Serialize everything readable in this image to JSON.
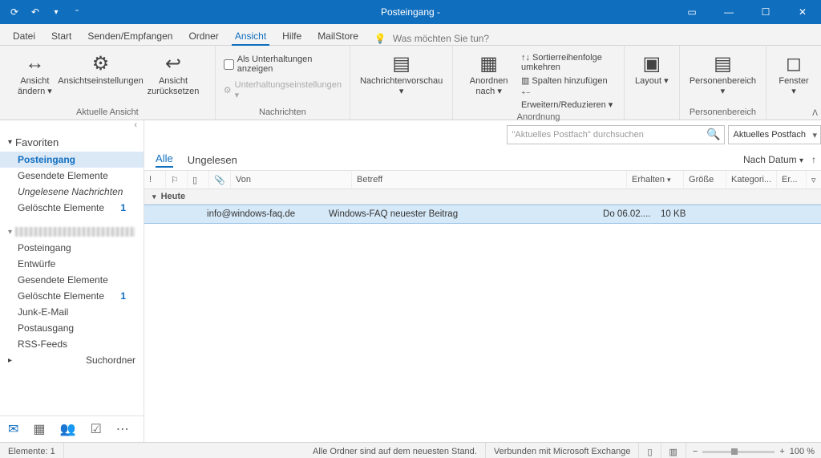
{
  "title": "Posteingang -",
  "tabs": [
    "Datei",
    "Start",
    "Senden/Empfangen",
    "Ordner",
    "Ansicht",
    "Hilfe",
    "MailStore"
  ],
  "active_tab": 4,
  "tell_placeholder": "Was möchten Sie tun?",
  "ribbon": {
    "g1": {
      "label": "Aktuelle Ansicht",
      "btn1": "Ansicht\nändern ▾",
      "btn2": "Ansichtseinstellungen",
      "btn3": "Ansicht\nzurücksetzen"
    },
    "g2": {
      "label": "Nachrichten",
      "chk": "Als Unterhaltungen anzeigen",
      "dis": "Unterhaltungseinstellungen ▾",
      "btn": "Nachrichtenvorschau\n▾"
    },
    "g3": {
      "label": "Anordnung",
      "btn": "Anordnen\nnach ▾",
      "l1": "↑↓ Sortierreihenfolge umkehren",
      "l2": "▥ Spalten hinzufügen",
      "l3": "⁺⁻ Erweitern/Reduzieren ▾"
    },
    "g4": {
      "label": "",
      "btn": "Layout\n▾"
    },
    "g5": {
      "label": "Personenbereich",
      "btn": "Personenbereich\n▾"
    },
    "g6": {
      "label": "",
      "btn": "Fenster\n▾"
    }
  },
  "nav": {
    "fav": "Favoriten",
    "fav_items": [
      {
        "name": "Posteingang",
        "sel": true,
        "bold": true
      },
      {
        "name": "Gesendete Elemente"
      },
      {
        "name": "Ungelesene Nachrichten",
        "ital": true
      },
      {
        "name": "Gelöschte Elemente",
        "count": "1"
      }
    ],
    "acct_items": [
      {
        "name": "Posteingang"
      },
      {
        "name": "Entwürfe"
      },
      {
        "name": "Gesendete Elemente"
      },
      {
        "name": "Gelöschte Elemente",
        "count": "1"
      },
      {
        "name": "Junk-E-Mail"
      },
      {
        "name": "Postausgang"
      },
      {
        "name": "RSS-Feeds"
      }
    ],
    "search_folders": "Suchordner"
  },
  "search_placeholder": "\"Aktuelles Postfach\" durchsuchen",
  "search_scope": "Aktuelles Postfach",
  "filter": {
    "all": "Alle",
    "unread": "Ungelesen",
    "sort": "Nach Datum"
  },
  "columns": {
    "from": "Von",
    "subject": "Betreff",
    "received": "Erhalten",
    "size": "Größe",
    "cat": "Kategori...",
    "fl": "Er..."
  },
  "group": "Heute",
  "msg": {
    "from": "info@windows-faq.de",
    "subject": "Windows-FAQ neuester Beitrag",
    "received": "Do 06.02....",
    "size": "10 KB"
  },
  "status": {
    "items": "Elemente: 1",
    "folders": "Alle Ordner sind auf dem neuesten Stand.",
    "conn": "Verbunden mit Microsoft Exchange",
    "zoom": "100 %"
  }
}
